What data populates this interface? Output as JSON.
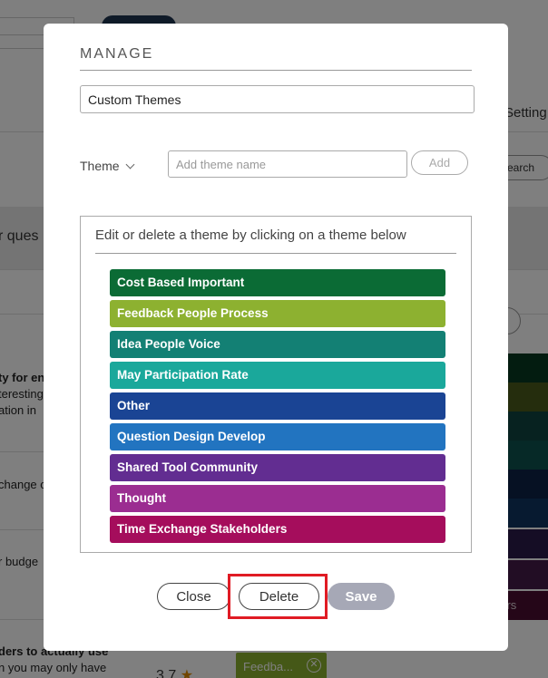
{
  "background": {
    "settings_label": "Setting",
    "search_label": "earch",
    "question_label": "r ques",
    "rows": [
      {
        "line1": "ty for en",
        "line2": "teresting",
        "line3": "ation in"
      },
      {
        "line1": "change o"
      },
      {
        "line1": "r budge"
      },
      {
        "line1": "ders to actually use",
        "line2": "n you may only have"
      }
    ],
    "stripe_labels": [
      "",
      "",
      "",
      "",
      "",
      "",
      "",
      "",
      "ders"
    ],
    "rating": "3.7",
    "tag_label": "Feedba...",
    "colors": {
      "stripes": [
        "#073821",
        "#4a5a1a",
        "#0e4440",
        "#0d524e",
        "#0c2247",
        "#0e3560",
        "#2b1a4a",
        "#451a48",
        "#4a0d31"
      ]
    }
  },
  "modal": {
    "title": "MANAGE",
    "name_value": "Custom Themes",
    "theme_dropdown_label": "Theme",
    "theme_input_placeholder": "Add theme name",
    "add_button": "Add",
    "list_hint": "Edit or delete a theme by clicking on a theme below",
    "themes": [
      {
        "label": "Cost Based Important",
        "color": "#0b6b35"
      },
      {
        "label": "Feedback People Process",
        "color": "#8db130"
      },
      {
        "label": "Idea People Voice",
        "color": "#138074"
      },
      {
        "label": "May Participation Rate",
        "color": "#1aa89b"
      },
      {
        "label": "Other",
        "color": "#1a4494"
      },
      {
        "label": "Question Design Develop",
        "color": "#2274c0"
      },
      {
        "label": "Shared Tool Community",
        "color": "#622d91"
      },
      {
        "label": "Thought",
        "color": "#9b2d91"
      },
      {
        "label": "Time Exchange Stakeholders",
        "color": "#a50d5c"
      }
    ],
    "buttons": {
      "close": "Close",
      "delete": "Delete",
      "save": "Save"
    },
    "colors": {
      "highlight": "#e01b24",
      "save_bg": "#a6a8b6"
    }
  }
}
